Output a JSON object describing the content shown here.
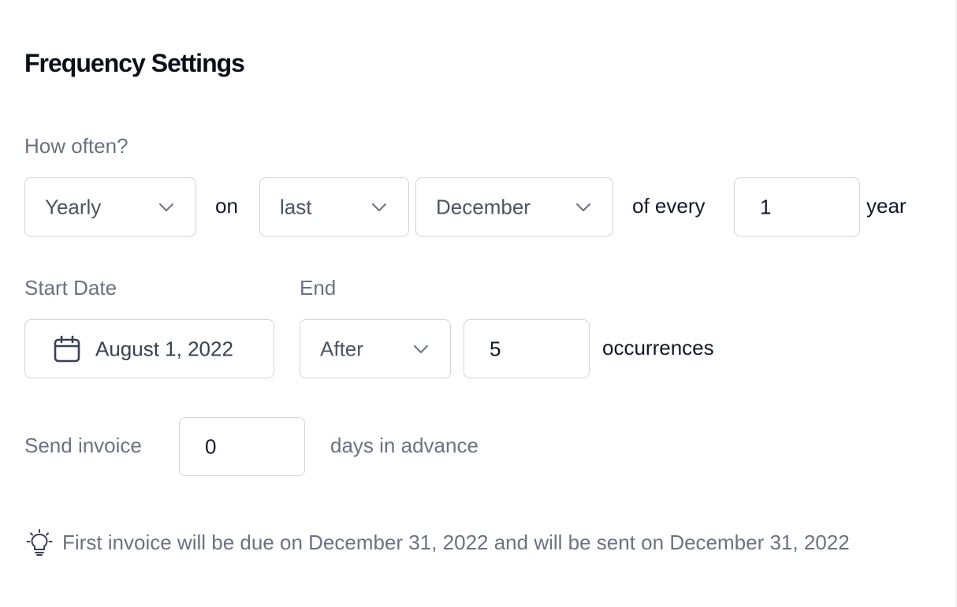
{
  "section": {
    "title": "Frequency Settings"
  },
  "frequency": {
    "label": "How often?",
    "period_value": "Yearly",
    "on_text": "on",
    "position_value": "last",
    "month_value": "December",
    "of_every_text": "of every",
    "interval_value": "1",
    "unit_text": "year"
  },
  "start": {
    "label": "Start Date",
    "value": "August 1, 2022",
    "icon": "calendar-icon"
  },
  "end": {
    "label": "End",
    "type_value": "After",
    "count_value": "5",
    "count_suffix": "occurrences"
  },
  "send": {
    "label": "Send invoice",
    "days_value": "0",
    "suffix": "days in advance"
  },
  "hint": {
    "icon": "lightbulb-icon",
    "text": "First invoice will be due on December 31, 2022 and will be sent on December 31, 2022"
  },
  "colors": {
    "heading": "#0b0f19",
    "label": "#6b7280",
    "border": "#d1d5db",
    "text": "#111827"
  }
}
